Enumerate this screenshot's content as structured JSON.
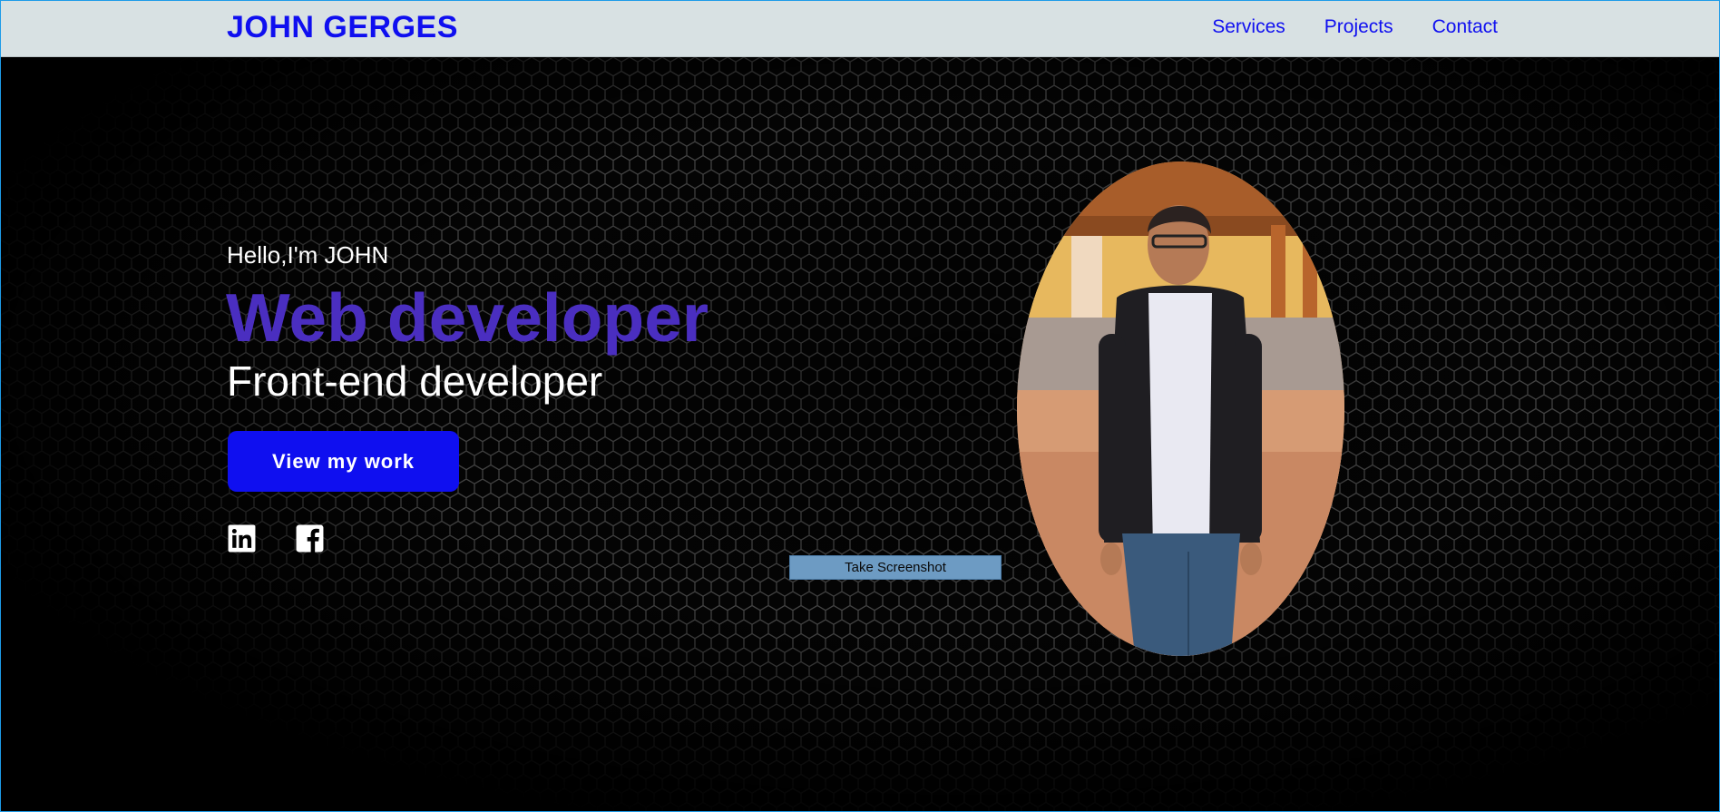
{
  "brand": "JOHN GERGES",
  "nav": {
    "items": [
      {
        "label": "Services"
      },
      {
        "label": "Projects"
      },
      {
        "label": "Contact"
      }
    ]
  },
  "hero": {
    "greeting": "Hello,I'm JOHN",
    "title": "Web developer",
    "subtitle": "Front-end developer",
    "cta_label": "View my work",
    "social": [
      {
        "icon": "linkedin-icon"
      },
      {
        "icon": "facebook-icon"
      }
    ],
    "portrait_alt": "portrait photo"
  },
  "overlay": {
    "screenshot_label": "Take Screenshot"
  },
  "colors": {
    "nav_bg": "#d8e1e3",
    "brand": "#0f0ff0",
    "title": "#4a2ec0",
    "cta_bg": "#0f0ff0",
    "frame_border": "#1e9be8"
  }
}
